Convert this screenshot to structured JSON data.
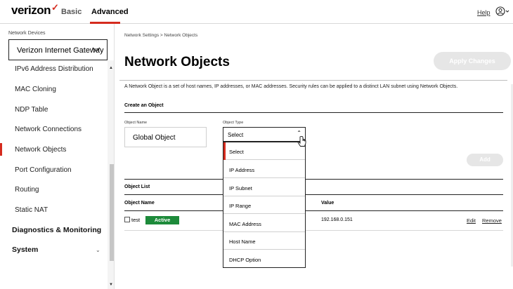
{
  "header": {
    "logo_text": "verizon",
    "logo_check": "✓",
    "nav_basic": "Basic",
    "nav_advanced": "Advanced",
    "help": "Help",
    "accent_color": "#d52b1e"
  },
  "sidebar": {
    "device_label": "Network Devices",
    "device_value": "Verizon Internet Gateway",
    "items": [
      {
        "label": "IPv6 Address Distribution"
      },
      {
        "label": "MAC Cloning"
      },
      {
        "label": "NDP Table"
      },
      {
        "label": "Network Connections"
      },
      {
        "label": "Network Objects"
      },
      {
        "label": "Port Configuration"
      },
      {
        "label": "Routing"
      },
      {
        "label": "Static NAT"
      }
    ],
    "groups": [
      {
        "label": "Diagnostics & Monitoring"
      },
      {
        "label": "System"
      }
    ]
  },
  "main": {
    "breadcrumb": "Network Settings  >  Network Objects",
    "title": "Network Objects",
    "apply_button": "Apply Changes",
    "description": "A Network Object is a set of host names, IP addresses, or MAC addresses. Security rules can be applied to a distinct LAN subnet using Network Objects.",
    "create_heading": "Create an Object",
    "name_label": "Object Name",
    "name_value": "Global Object",
    "type_label": "Object Type",
    "type_value": "Select",
    "type_options": [
      "Select",
      "IP Address",
      "IP Subnet",
      "IP Range",
      "MAC Address",
      "Host Name",
      "DHCP Option"
    ],
    "add_button": "Add",
    "list_heading": "Object List",
    "columns": {
      "name": "Object Name",
      "value": "Value"
    },
    "rows": [
      {
        "name": "test",
        "status": "Active",
        "value": "192.168.0.151",
        "edit": "Edit",
        "remove": "Remove"
      }
    ],
    "status_color": "#1d8a3a"
  }
}
